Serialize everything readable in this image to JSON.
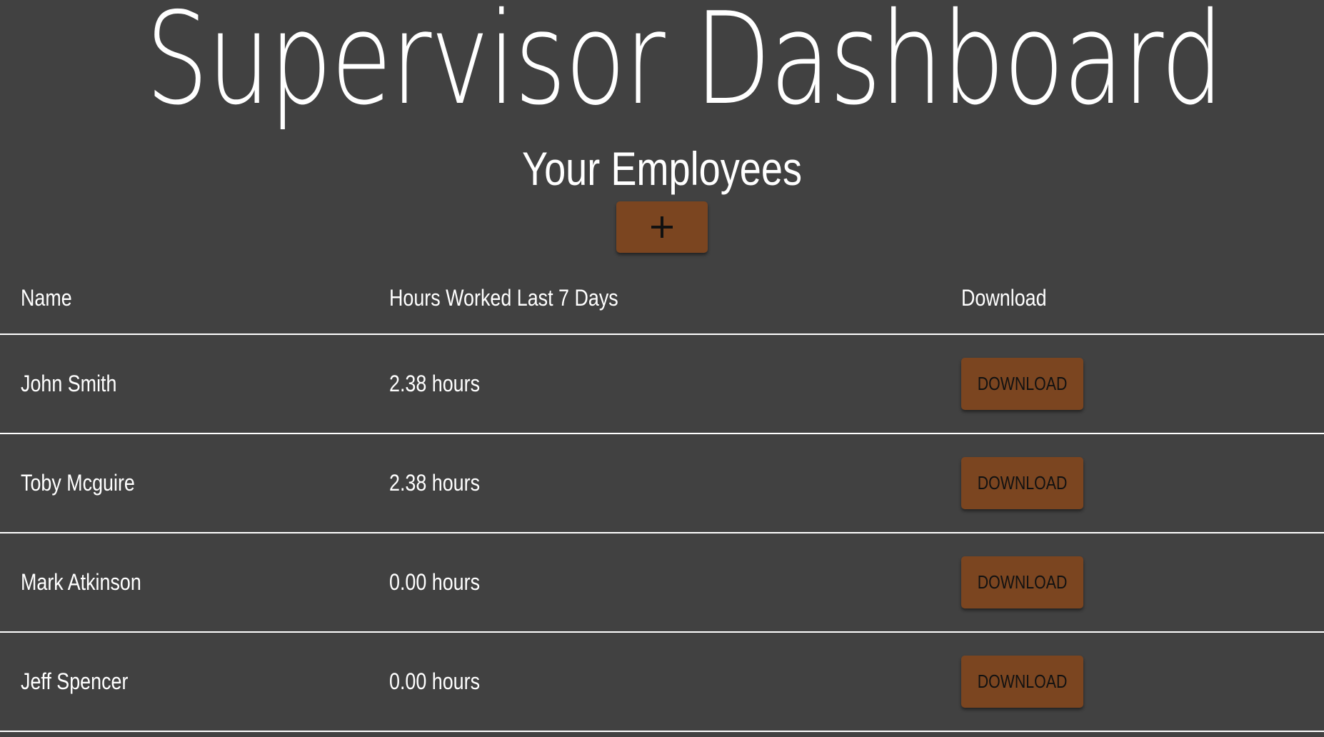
{
  "page": {
    "title": "Supervisor Dashboard",
    "section_heading": "Your Employees",
    "add_button_icon": "plus-icon"
  },
  "table": {
    "headers": {
      "name": "Name",
      "hours": "Hours Worked Last 7 Days",
      "download": "Download"
    },
    "rows": [
      {
        "name": "John Smith",
        "hours": "2.38 hours",
        "download_label": "DOWNLOAD"
      },
      {
        "name": "Toby Mcguire",
        "hours": "2.38 hours",
        "download_label": "DOWNLOAD"
      },
      {
        "name": "Mark Atkinson",
        "hours": "0.00 hours",
        "download_label": "DOWNLOAD"
      },
      {
        "name": "Jeff Spencer",
        "hours": "0.00 hours",
        "download_label": "DOWNLOAD"
      }
    ]
  },
  "colors": {
    "background": "#414141",
    "accent_button": "#7b4520",
    "text": "#ffffff",
    "button_text": "#111111"
  }
}
